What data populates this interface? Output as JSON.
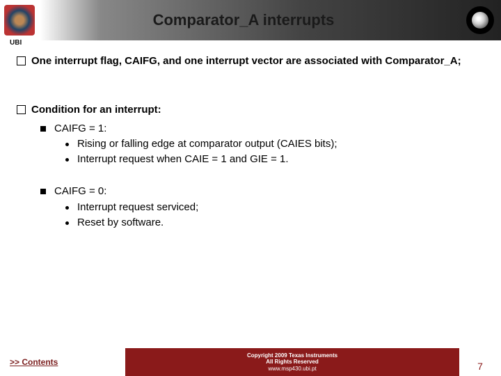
{
  "header": {
    "title": "Comparator_A interrupts",
    "ubi": "UBI"
  },
  "content": {
    "p1": "One interrupt flag, CAIFG, and one interrupt vector are associated with Comparator_A;",
    "p2": "Condition for an interrupt:",
    "p2a": "CAIFG = 1:",
    "p2a1": "Rising or falling edge at comparator output (CAIES bits);",
    "p2a2": "Interrupt request when CAIE = 1 and GIE = 1.",
    "p2b": "CAIFG = 0:",
    "p2b1": "Interrupt request serviced;",
    "p2b2": "Reset by software."
  },
  "footer": {
    "contents": ">> Contents",
    "copyright": "Copyright  2009 Texas Instruments",
    "rights": "All Rights Reserved",
    "url": "www.msp430.ubi.pt",
    "page": "7"
  }
}
